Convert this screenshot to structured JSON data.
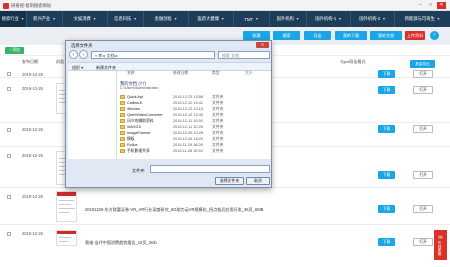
{
  "window": {
    "title": "研报搜-复制搜索网站"
  },
  "nav": {
    "tabs": [
      {
        "label": "搜索行业",
        "caret": "▼"
      },
      {
        "label": "新兴产业",
        "caret": "▼"
      },
      {
        "label": "文娱消费",
        "caret": "▼"
      },
      {
        "label": "信息科技",
        "caret": "▼"
      },
      {
        "label": "金融创投",
        "caret": "▼"
      },
      {
        "label": "医药大健康",
        "caret": "▼"
      },
      {
        "label": "TMT",
        "caret": "▼"
      },
      {
        "label": "国外机构",
        "caret": "▼"
      },
      {
        "label": "国外机构-1",
        "caret": "▼"
      },
      {
        "label": "国外机构-2",
        "caret": "▼"
      },
      {
        "label": "新能源与可再生",
        "caret": "▼"
      }
    ]
  },
  "toolbar": {
    "btn1": "收藏",
    "btn2": "搜索",
    "btn3": "导出",
    "btn4": "我的下载",
    "btn5": "我的文档",
    "btn6": "上传资料",
    "circle": "○"
  },
  "list": {
    "add_label": "+ 添加",
    "col_date": "发布日期",
    "col_cover": "封面",
    "col_format": "导出格式",
    "side_button": "批量导出",
    "format_value": "与pdf导出格式"
  },
  "rows": [
    {
      "date": "2019-12-26",
      "title": "",
      "download": "下载",
      "open": "打开"
    },
    {
      "date": "2019-12-26",
      "title": "",
      "download": "下载",
      "open": "打开"
    },
    {
      "date": "2019-12-26",
      "title": "",
      "download": "下载",
      "open": "打开"
    },
    {
      "date": "2019-12-26",
      "title": "",
      "download": "下载",
      "open": "打开"
    },
    {
      "date": "2019-12-26",
      "title": "20191226-东方财富证券-VR_AR行业深度研究_5G助力云VR规模化_拐点临近应用开发_36页_6MB",
      "download": "下载",
      "open": "打开"
    },
    {
      "date": "2019-12-26",
      "title": "奥维-当代中国消费趋势报告_10页_3mb",
      "download": "下载",
      "open": "打开"
    }
  ],
  "fab": {
    "label": "在线客服"
  },
  "dialog": {
    "title": "选择文件夹",
    "close": "✕",
    "path": "« 库 ▸ 文档 ▸",
    "search_placeholder": "搜索 文档",
    "cmd_organize": "组织 ▾",
    "cmd_new_folder": "新建文件夹",
    "col_name": "名称",
    "col_date": "修改日期",
    "col_type": "类型",
    "col_size": "大小",
    "library_title": "我的文档 (77)",
    "library_path": "C:\\Users\\Administrator",
    "files": [
      {
        "name": "QuickJrpt",
        "date": "2019-12-23 13:58",
        "type": "文件夹"
      },
      {
        "name": "Calibia-K",
        "date": "2019-12-20 15:41",
        "type": "文件夹"
      },
      {
        "name": "iMovies",
        "date": "2019-12-12 13:15",
        "type": "文件夹"
      },
      {
        "name": "QuertVideoConverter",
        "date": "2019-12-12 13:40",
        "type": "文件夹"
      },
      {
        "name": "讯众的辅助资料",
        "date": "2019-12-11 10:50",
        "type": "文件夹"
      },
      {
        "name": "WAXGS",
        "date": "2019-12-11 10:28",
        "type": "文件夹"
      },
      {
        "name": "ImageForever",
        "date": "2019-12-09 10:26",
        "type": "文件夹"
      },
      {
        "name": "模板",
        "date": "2019-12-06 18:20",
        "type": "文件夹"
      },
      {
        "name": "Rollux",
        "date": "2019-11-29 18:26",
        "type": "文件夹"
      },
      {
        "name": "手机影视共享",
        "date": "2019-11-28 10:54",
        "type": "文件夹"
      }
    ],
    "filename_label": "文件夹:",
    "select_button": "选择文件夹",
    "cancel_button": "取消"
  }
}
